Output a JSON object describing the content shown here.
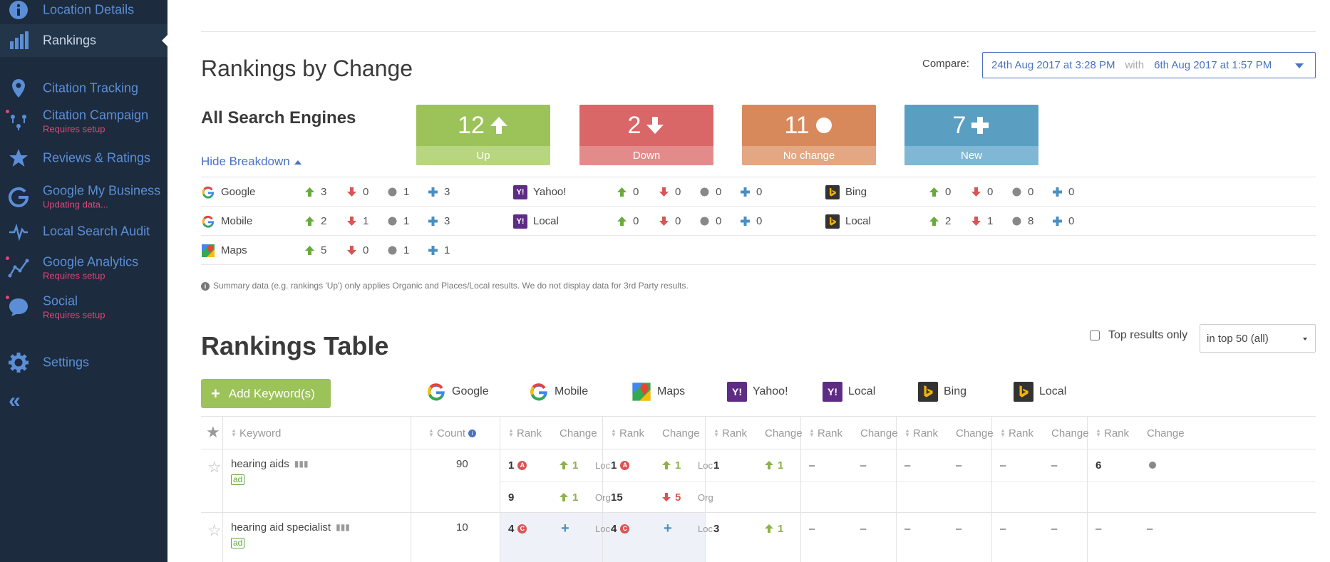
{
  "sidebar": {
    "items": [
      {
        "label": "Location Details",
        "sub": "",
        "icon": "info-icon",
        "active": false,
        "dot": false
      },
      {
        "label": "Rankings",
        "sub": "",
        "icon": "bar-chart-icon",
        "active": true,
        "dot": false
      },
      {
        "label": "Citation Tracking",
        "sub": "",
        "icon": "map-pin-icon",
        "active": false,
        "dot": false
      },
      {
        "label": "Citation Campaign",
        "sub": "Requires setup",
        "icon": "pins-icon",
        "active": false,
        "dot": true
      },
      {
        "label": "Reviews & Ratings",
        "sub": "",
        "icon": "star-icon",
        "active": false,
        "dot": false
      },
      {
        "label": "Google My Business",
        "sub": "Updating data...",
        "icon": "google-icon",
        "active": false,
        "dot": false
      },
      {
        "label": "Local Search Audit",
        "sub": "",
        "icon": "pulse-icon",
        "active": false,
        "dot": false
      },
      {
        "label": "Google Analytics",
        "sub": "Requires setup",
        "icon": "analytics-icon",
        "active": false,
        "dot": true
      },
      {
        "label": "Social",
        "sub": "Requires setup",
        "icon": "chat-icon",
        "active": false,
        "dot": true
      },
      {
        "label": "Settings",
        "sub": "",
        "icon": "gear-icon",
        "active": false,
        "dot": false
      }
    ],
    "collapse_label": "«"
  },
  "changes": {
    "title": "Rankings by Change",
    "compare_label": "Compare:",
    "compare_from": "24th Aug 2017 at 3:28 PM",
    "compare_with": "with",
    "compare_to": "6th Aug 2017 at 1:57 PM",
    "engines_title": "All Search Engines",
    "hide_breakdown": "Hide Breakdown",
    "cards": [
      {
        "value": "12",
        "label": "Up"
      },
      {
        "value": "2",
        "label": "Down"
      },
      {
        "value": "11",
        "label": "No change"
      },
      {
        "value": "7",
        "label": "New"
      }
    ],
    "breakdown": [
      [
        {
          "name": "Google",
          "up": "3",
          "down": "0",
          "same": "1",
          "new": "3"
        },
        {
          "name": "Yahoo!",
          "up": "0",
          "down": "0",
          "same": "0",
          "new": "0"
        },
        {
          "name": "Bing",
          "up": "0",
          "down": "0",
          "same": "0",
          "new": "0"
        }
      ],
      [
        {
          "name": "Mobile",
          "up": "2",
          "down": "1",
          "same": "1",
          "new": "3"
        },
        {
          "name": "Local",
          "up": "0",
          "down": "0",
          "same": "0",
          "new": "0"
        },
        {
          "name": "Local",
          "up": "2",
          "down": "1",
          "same": "8",
          "new": "0"
        }
      ],
      [
        {
          "name": "Maps",
          "up": "5",
          "down": "0",
          "same": "1",
          "new": "1"
        }
      ]
    ],
    "note": "Summary data (e.g. rankings 'Up') only applies Organic and Places/Local results. We do not display data for 3rd Party results."
  },
  "table": {
    "title": "Rankings Table",
    "top_only_label": "Top results only",
    "top_select_value": "in top 50 (all)",
    "add_keyword_label": "Add Keyword(s)",
    "engines": [
      "Google",
      "Mobile",
      "Maps",
      "Yahoo!",
      "Local",
      "Bing",
      "Local"
    ],
    "col_keyword": "Keyword",
    "col_count": "Count",
    "col_rank": "Rank",
    "col_change": "Change",
    "rows": [
      {
        "keyword": "hearing aids",
        "ad": "ad",
        "count": "90",
        "google": {
          "rank": "1",
          "badge": "A",
          "change": "1",
          "type": "Loc",
          "rank2": "9",
          "change2": "1",
          "type2": "Org"
        },
        "mobile": {
          "rank": "1",
          "badge": "A",
          "change": "1",
          "type": "Loc",
          "rank2": "15",
          "change2": "5",
          "type2": "Org"
        },
        "maps": {
          "rank": "1",
          "change": "1"
        },
        "yahoo": {
          "rank": "–",
          "change": "–"
        },
        "ylocal": {
          "rank": "–",
          "change": "–"
        },
        "bing": {
          "rank": "–",
          "change": "–"
        },
        "blocal": {
          "rank": "6",
          "change": ""
        }
      },
      {
        "keyword": "hearing aid specialist",
        "ad": "ad",
        "count": "10",
        "google": {
          "rank": "4",
          "badge": "C",
          "type": "Loc"
        },
        "mobile": {
          "rank": "4",
          "badge": "C",
          "type": "Loc"
        },
        "maps": {
          "rank": "3",
          "change": "1"
        },
        "yahoo": {
          "rank": "–",
          "change": "–"
        },
        "ylocal": {
          "rank": "–",
          "change": "–"
        },
        "bing": {
          "rank": "–",
          "change": "–"
        },
        "blocal": {
          "rank": "–",
          "change": "–"
        }
      }
    ]
  },
  "colors": {
    "sidebar": "#1c2b3d",
    "accent": "#4a72c0",
    "up": "#9cc25a",
    "down": "#d96767",
    "nochange": "#d8895c",
    "new": "#5a9fc2"
  }
}
